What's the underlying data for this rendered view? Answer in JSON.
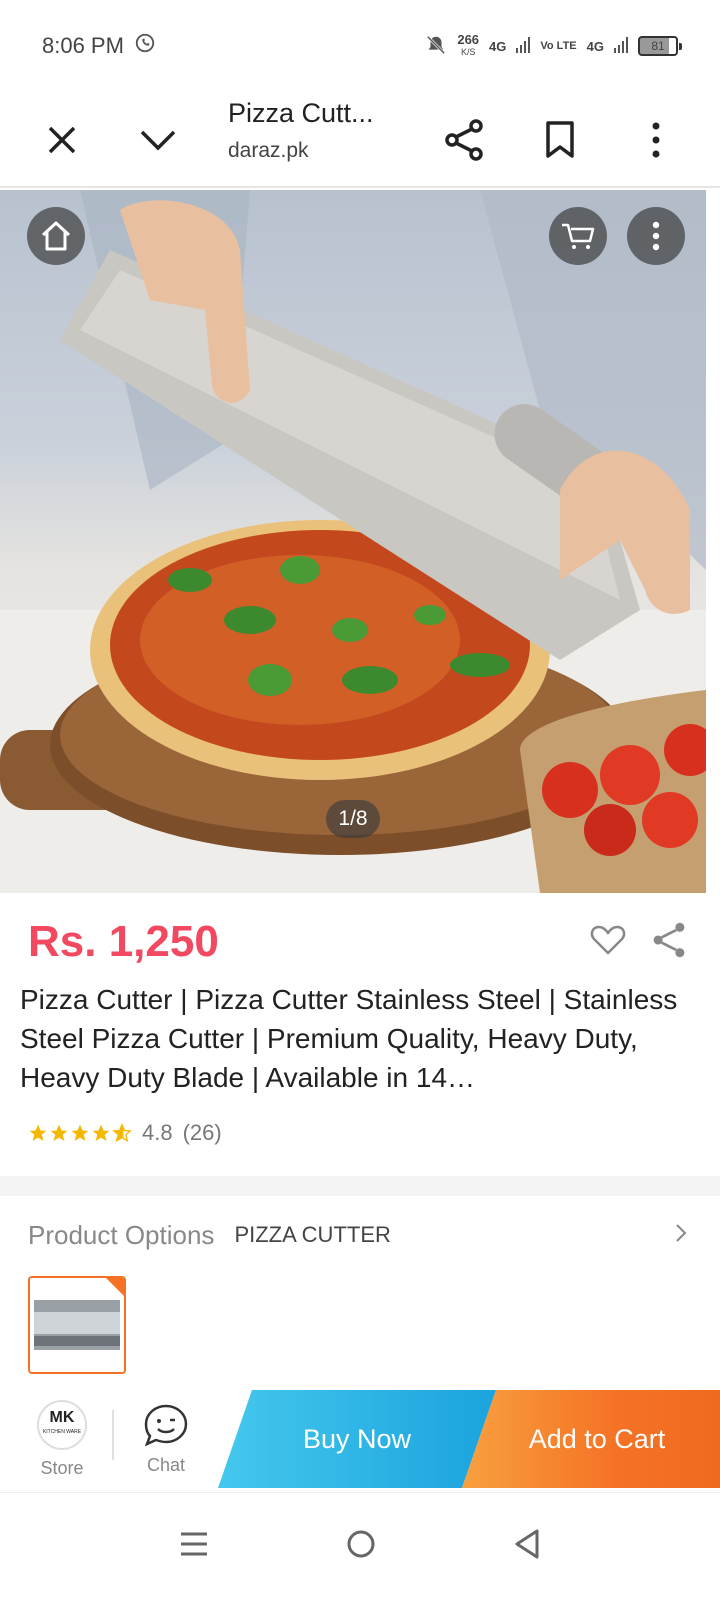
{
  "status_bar": {
    "time": "8:06 PM",
    "net_speed": "266",
    "net_speed_unit": "K/S",
    "signal_1": "4G",
    "signal_volte": "Vo LTE",
    "signal_2": "4G",
    "battery": "81"
  },
  "toolbar": {
    "title": "Pizza Cutt...",
    "url": "daraz.pk"
  },
  "gallery": {
    "pager": "1/8"
  },
  "product": {
    "price": "Rs. 1,250",
    "title": "Pizza Cutter | Pizza Cutter Stainless Steel | Stainless Steel Pizza Cutter | Premium Quality, Heavy Duty, Heavy Duty Blade | Available in 14…",
    "rating_value": "4.8",
    "rating_count": "(26)",
    "rating_stars": 4.8
  },
  "options": {
    "label": "Product Options",
    "value": "PIZZA CUTTER"
  },
  "action_bar": {
    "store_label": "Store",
    "store_logo_text": "MK",
    "store_logo_sub": "KITCHEN WARE",
    "chat_label": "Chat",
    "buy_now": "Buy Now",
    "add_to_cart": "Add to Cart"
  },
  "colors": {
    "price": "#f24961",
    "buy_now": "#1aa3dd",
    "add_to_cart": "#f57224",
    "star": "#f5b800"
  }
}
